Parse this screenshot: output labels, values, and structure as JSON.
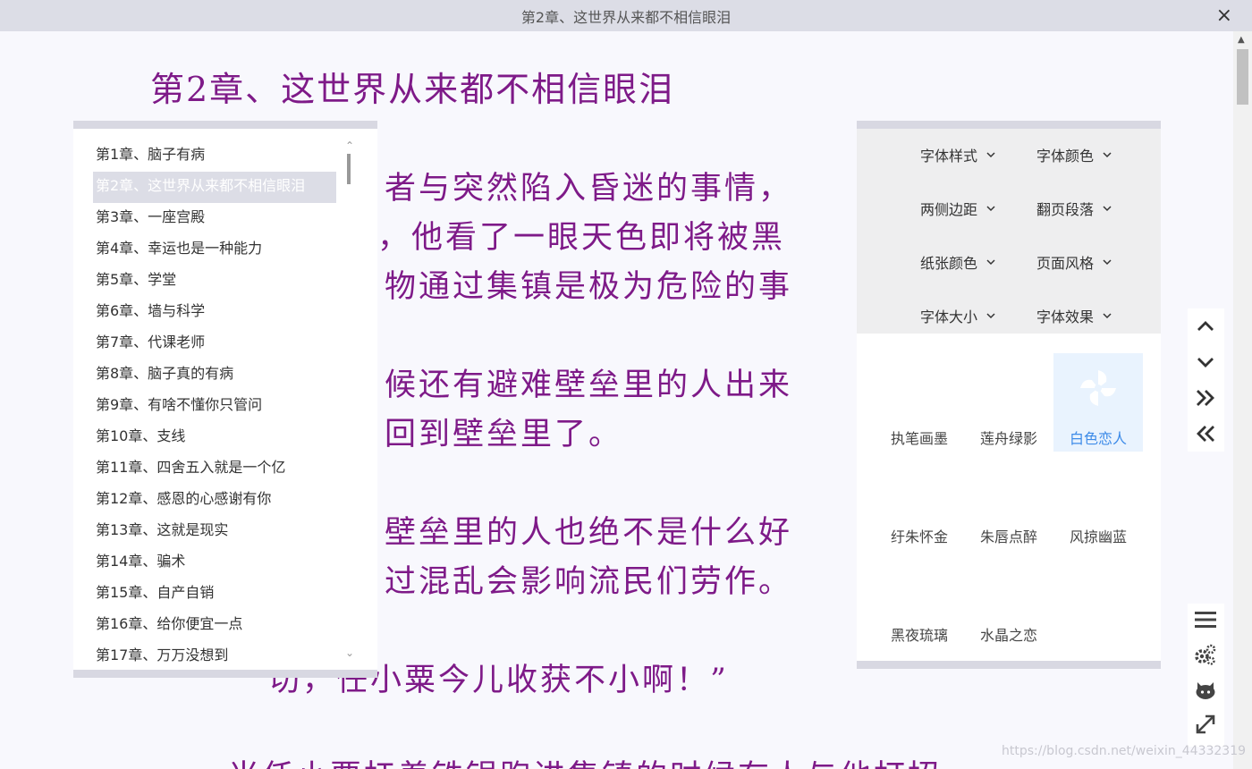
{
  "window": {
    "title": "第2章、这世界从来都不相信眼泪",
    "close_glyph": "×"
  },
  "reader": {
    "chapter_title": "第2章、这世界从来都不相信眼泪",
    "lines": [
      "者与突然陷入昏迷的事情，",
      "，他看了一眼天色即将被黑",
      "物通过集镇是极为危险的事",
      "候还有避难壁垒里的人出来",
      "回到壁垒里了。",
      "壁垒里的人也绝不是什么好",
      "过混乱会影响流民们劳作。",
      "切，任小粟今儿收获不小啊！”",
      "当任小粟扛着铁锅跑进集镇的时候有人与他打招"
    ]
  },
  "chapter_list": {
    "items": [
      "第1章、脑子有病",
      "第2章、这世界从来都不相信眼泪",
      "第3章、一座宫殿",
      "第4章、幸运也是一种能力",
      "第5章、学堂",
      "第6章、墙与科学",
      "第7章、代课老师",
      "第8章、脑子真的有病",
      "第9章、有啥不懂你只管问",
      "第10章、支线",
      "第11章、四舍五入就是一个亿",
      "第12章、感恩的心感谢有你",
      "第13章、这就是现实",
      "第14章、骗术",
      "第15章、自产自销",
      "第16章、给你便宜一点",
      "第17章、万万没想到"
    ],
    "active_index": 1,
    "scroll_up_glyph": "⌃",
    "scroll_down_glyph": "⌄"
  },
  "settings": {
    "menu": {
      "font_style": "字体样式",
      "font_color": "字体颜色",
      "margins": "两侧边距",
      "paging": "翻页段落",
      "paper_color": "纸张颜色",
      "page_style": "页面风格",
      "font_size": "字体大小",
      "font_effect": "字体效果"
    },
    "themes": {
      "t1": "执笔画墨",
      "t2": "莲舟绿影",
      "t3": "白色恋人",
      "t4": "纡朱怀金",
      "t5": "朱唇点醉",
      "t6": "风掠幽蓝",
      "t7": "黑夜琉璃",
      "t8": "水晶之恋"
    },
    "selected_theme": "白色恋人",
    "accent_color": "#3d8be8"
  },
  "colors": {
    "text": "#7e1a88",
    "page_bg": "#f8f8fd",
    "selected_bg": "#dcdde6"
  },
  "watermark": "https://blog.csdn.net/weixin_44332319"
}
